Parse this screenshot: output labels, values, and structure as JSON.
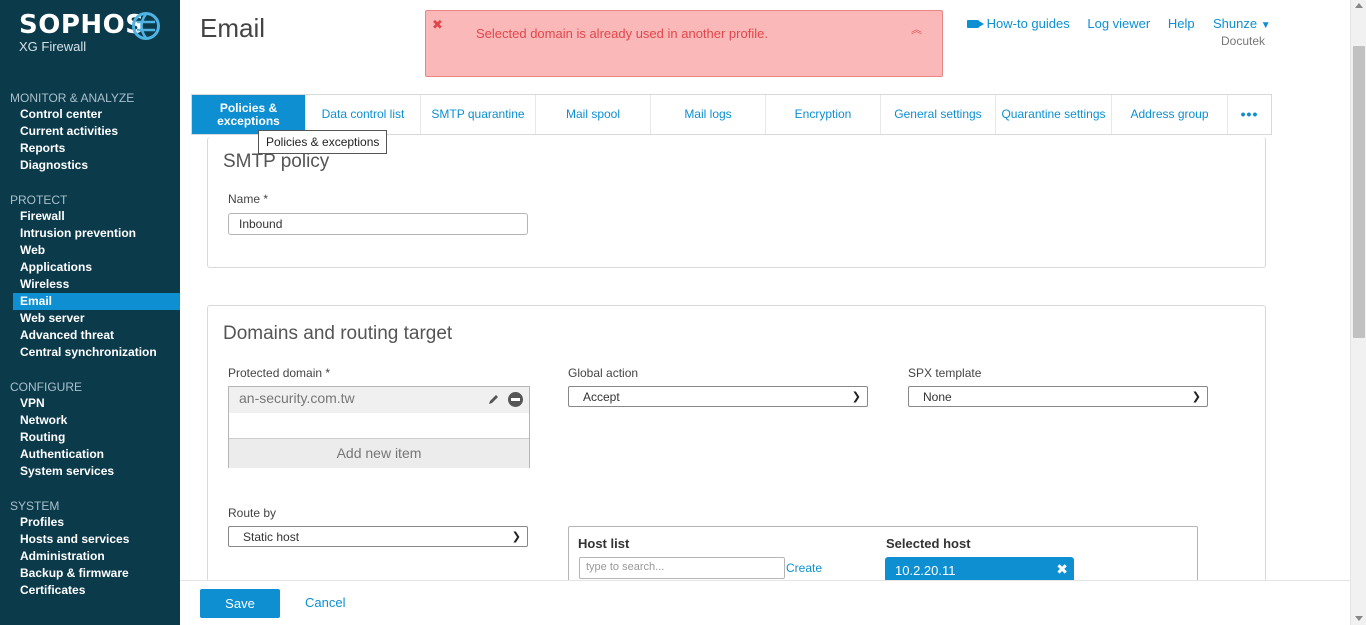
{
  "brand": {
    "name": "SOPHOS",
    "product": "XG Firewall"
  },
  "sidebar": {
    "sections": [
      {
        "heading": "MONITOR & ANALYZE",
        "items": [
          "Control center",
          "Current activities",
          "Reports",
          "Diagnostics"
        ]
      },
      {
        "heading": "PROTECT",
        "items": [
          "Firewall",
          "Intrusion prevention",
          "Web",
          "Applications",
          "Wireless",
          "Email",
          "Web server",
          "Advanced threat",
          "Central synchronization"
        ]
      },
      {
        "heading": "CONFIGURE",
        "items": [
          "VPN",
          "Network",
          "Routing",
          "Authentication",
          "System services"
        ]
      },
      {
        "heading": "SYSTEM",
        "items": [
          "Profiles",
          "Hosts and services",
          "Administration",
          "Backup & firmware",
          "Certificates"
        ]
      }
    ],
    "active_item": "Email"
  },
  "header": {
    "title": "Email",
    "alert": "Selected domain is already used in another profile.",
    "links": {
      "howto": "How-to guides",
      "logviewer": "Log viewer",
      "help": "Help"
    },
    "user": {
      "name": "Shunze",
      "org": "Docutek"
    }
  },
  "tabs": [
    "Policies & exceptions",
    "Data control list",
    "SMTP quarantine",
    "Mail spool",
    "Mail logs",
    "Encryption",
    "General settings",
    "Quarantine settings",
    "Address group",
    "•••"
  ],
  "tooltip": "Policies & exceptions",
  "smtp_policy": {
    "title": "SMTP policy",
    "name_label": "Name *",
    "name_value": "Inbound"
  },
  "domains": {
    "title": "Domains and routing target",
    "protected_label": "Protected domain *",
    "domain_item": "an-security.com.tw",
    "add_item": "Add new item",
    "global_action_label": "Global action",
    "global_action_value": "Accept",
    "spx_label": "SPX template",
    "spx_value": "None",
    "route_by_label": "Route by",
    "route_by_value": "Static host",
    "host_list_label": "Host list",
    "search_placeholder": "type to search...",
    "create_label": "Create",
    "selected_host_label": "Selected host",
    "selected_host_value": "10.2.20.11"
  },
  "footer": {
    "save": "Save",
    "cancel": "Cancel"
  }
}
